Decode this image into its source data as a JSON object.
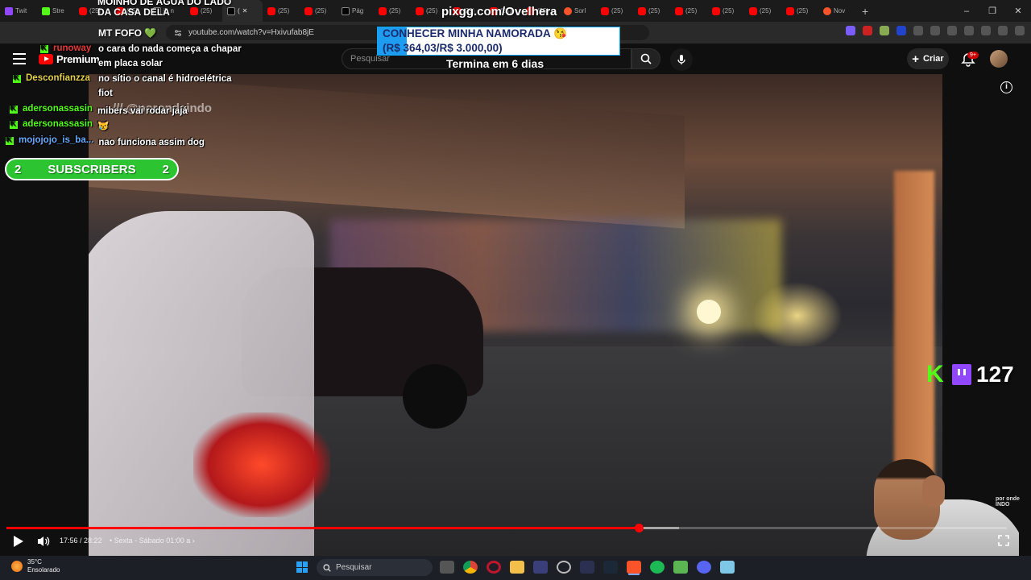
{
  "browser": {
    "tabs": [
      {
        "label": "Twit",
        "icon": "twitch-favicon"
      },
      {
        "label": "Stre",
        "icon": "kick-favicon"
      },
      {
        "label": "(25)",
        "icon": "youtube-favicon"
      },
      {
        "label": "(25)",
        "icon": "youtube-favicon"
      },
      {
        "label": "jb n",
        "icon": "x-favicon"
      },
      {
        "label": "(25)",
        "icon": "youtube-favicon"
      },
      {
        "label": "(",
        "icon": "speaker-favicon",
        "active": true
      },
      {
        "label": "(25)",
        "icon": "youtube-favicon"
      },
      {
        "label": "(25)",
        "icon": "youtube-favicon"
      },
      {
        "label": "Pág",
        "icon": "x-favicon"
      },
      {
        "label": "(25)",
        "icon": "youtube-favicon"
      },
      {
        "label": "(25)",
        "icon": "youtube-favicon"
      },
      {
        "label": "(25)",
        "icon": "youtube-favicon"
      },
      {
        "label": "(25)",
        "icon": "youtube-favicon"
      },
      {
        "label": "(25)",
        "icon": "youtube-favicon"
      },
      {
        "label": "Sorl",
        "icon": "brave-favicon"
      },
      {
        "label": "(25)",
        "icon": "youtube-favicon"
      },
      {
        "label": "(25)",
        "icon": "youtube-favicon"
      },
      {
        "label": "(25)",
        "icon": "youtube-favicon"
      },
      {
        "label": "(25)",
        "icon": "youtube-favicon"
      },
      {
        "label": "(25)",
        "icon": "youtube-favicon"
      },
      {
        "label": "(25)",
        "icon": "youtube-favicon"
      },
      {
        "label": "Nov",
        "icon": "brave-favicon"
      }
    ],
    "new_tab": "+",
    "window_controls": [
      "–",
      "❐",
      "✕"
    ],
    "url": "youtube.com/watch?v=Hxivufab8jE"
  },
  "youtube": {
    "logo_text": "Premium",
    "search_placeholder": "Pesquisar",
    "create_label": "Criar",
    "notification_badge": "9+"
  },
  "overlay": {
    "donation_text": "MOINHO DE ÁGUA DO LADO DA CASA DELA",
    "donation_user": "MT FOFO",
    "pix_title": "pixgg.com/Ovelhera",
    "pix_goal": "CONHECER MINHA NAMORADA 😘",
    "pix_amount": "(R$ 364,03/R$ 3.000,00)",
    "pix_progress": 0.1213,
    "pix_deadline": "Termina em 6 dias",
    "watermark": "/// @porondeindo",
    "subs_left": "2",
    "subs_label": "SUBSCRIBERS",
    "subs_right": "2",
    "viewer_count": "127",
    "channel_logo": "por onde INDO"
  },
  "chat": [
    {
      "user": "runoway",
      "color": "#e63a3a",
      "message": "o cara do nada começa a chapar em placa solar"
    },
    {
      "user": "Desconfianzza",
      "color": "#e6d24a",
      "message": "no sítio o canal é hidroelétrica fiot"
    },
    {
      "user": "adersonassasin",
      "color": "#53fc18",
      "message": "mibers vai rodar jajá"
    },
    {
      "user": "adersonassasin",
      "color": "#53fc18",
      "message": "😿"
    },
    {
      "user": "mojojojo_is_ba...",
      "color": "#66aaff",
      "message": "nao funciona assim dog"
    }
  ],
  "player": {
    "current_time": "17:56",
    "duration": "28:22",
    "chapter": "• Sexta - Sábado 01:00 a",
    "progress": 0.632,
    "buffered": 0.672
  },
  "taskbar": {
    "temperature": "35°C",
    "weather": "Ensolarado",
    "search_label": "Pesquisar"
  }
}
